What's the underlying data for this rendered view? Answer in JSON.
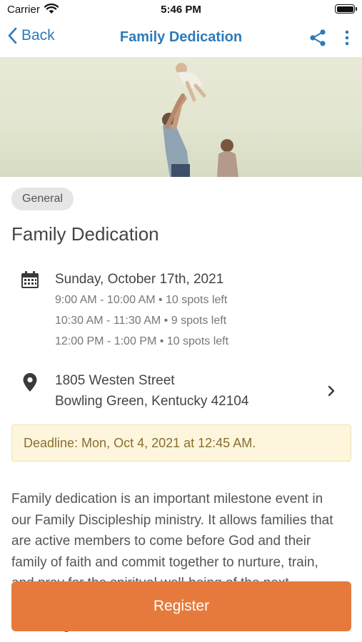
{
  "status_bar": {
    "carrier": "Carrier",
    "time": "5:46 PM"
  },
  "nav": {
    "back_label": "Back",
    "title": "Family Dedication"
  },
  "event": {
    "category": "General",
    "title": "Family Dedication",
    "date": "Sunday, October 17th, 2021",
    "time_slots": [
      "9:00 AM - 10:00 AM • 10 spots left",
      "10:30 AM - 11:30 AM • 9 spots left",
      "12:00 PM - 1:00 PM • 10 spots left"
    ],
    "address": {
      "line1": "1805 Westen Street",
      "line2": "Bowling Green, Kentucky 42104"
    },
    "deadline": "Deadline: Mon, Oct 4, 2021 at 12:45 AM.",
    "description_lines": [
      "Family dedication is an important milestone event in",
      "our Family Discipleship ministry. It allows families that",
      "are active members to come before God and their",
      "family of faith and commit together to nurture, train,",
      "and pray for the spiritual well-being of the next",
      "",
      "hour. Registration deadline is October 3"
    ]
  },
  "actions": {
    "register_label": "Register"
  },
  "colors": {
    "accent": "#2e7ab8",
    "register": "#e67a3c",
    "deadline_bg": "#fdf6dd"
  },
  "icons": [
    "wifi-icon",
    "battery-icon",
    "chevron-left-icon",
    "share-icon",
    "more-vertical-icon",
    "calendar-icon",
    "location-pin-icon",
    "chevron-right-icon"
  ]
}
